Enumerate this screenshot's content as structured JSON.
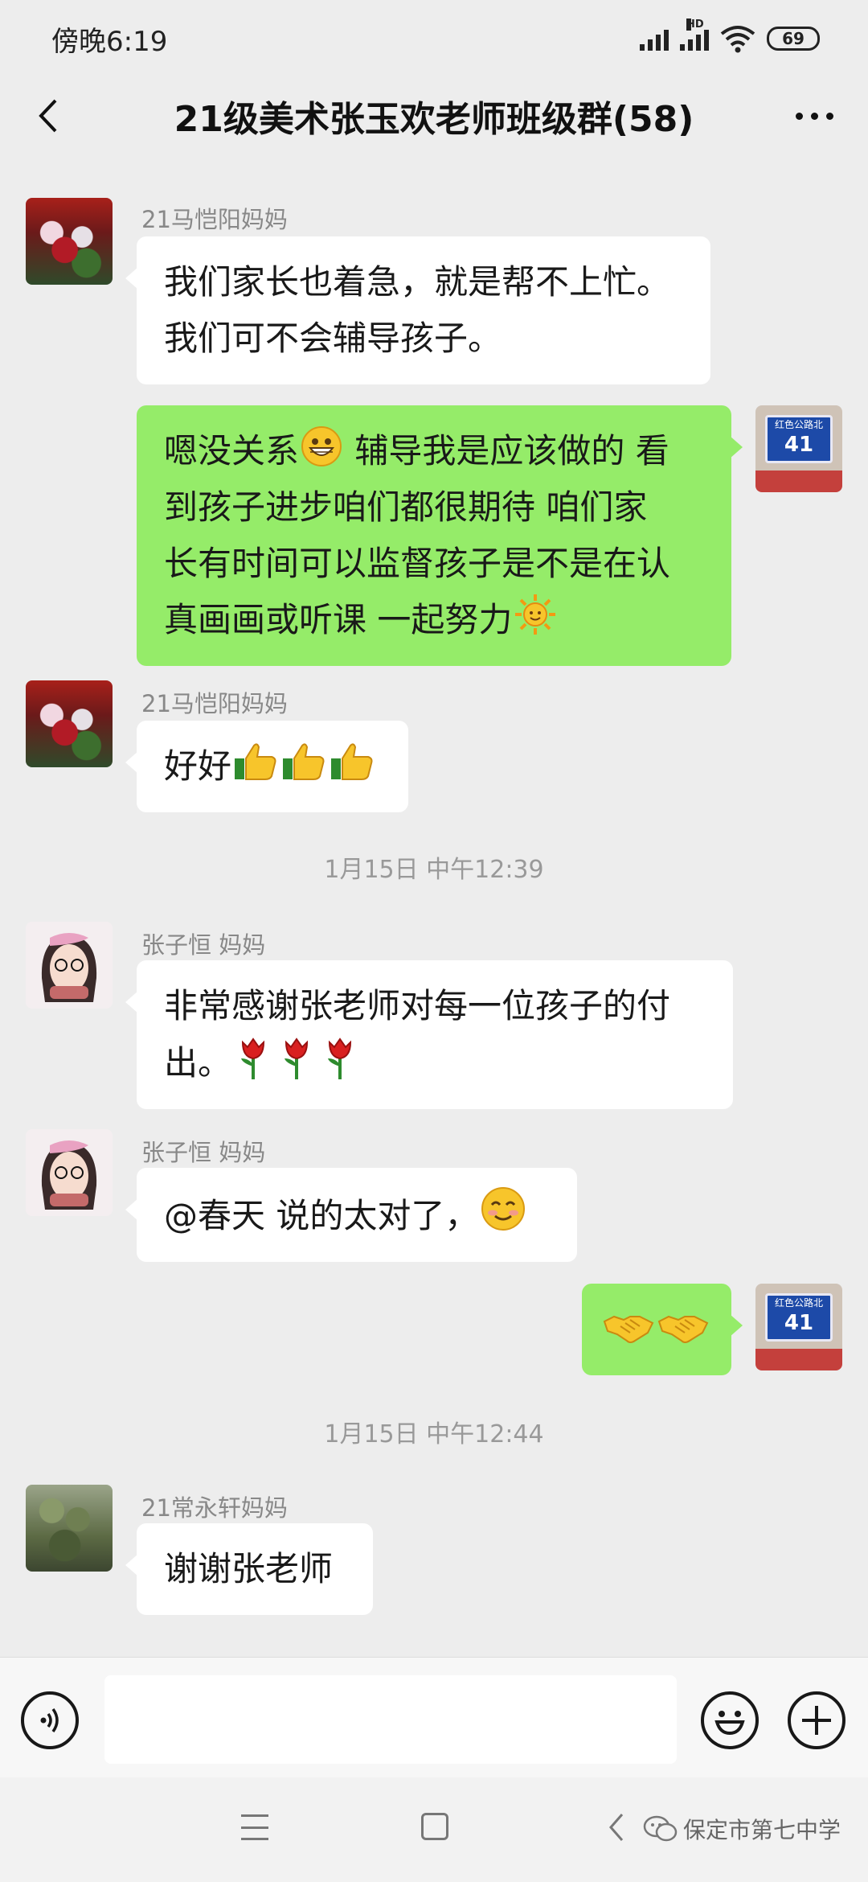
{
  "status_bar": {
    "time": "傍晚6:19",
    "hd": "HD",
    "battery": "69"
  },
  "header": {
    "title": "21级美术张玉欢老师班级群(58)"
  },
  "messages": [
    {
      "sender": "21马恺阳妈妈",
      "lines": [
        "我们家长也着急，就是帮不上忙。",
        "我们可不会辅导孩子。"
      ]
    },
    {
      "lines": [
        "嗯没关系",
        " 辅导我是应该做的 看",
        "到孩子进步咱们都很期待 咱们家",
        "长有时间可以监督孩子是不是在认",
        "真画画或听课 一起努力"
      ]
    },
    {
      "sender": "21马恺阳妈妈",
      "text": "好好"
    },
    {
      "sender": "张子恒  妈妈",
      "lines": [
        "非常感谢张老师对每一位孩子的付",
        "出。"
      ]
    },
    {
      "sender": "张子恒  妈妈",
      "text": "@春天  说的太对了，"
    },
    {
      "text": ""
    },
    {
      "sender": "21常永轩妈妈",
      "text": "谢谢张老师"
    }
  ],
  "timestamps": [
    "1月15日 中午12:39",
    "1月15日 中午12:44"
  ],
  "avatar_sign": {
    "line1": "红色公路北",
    "line2": "41"
  },
  "watermark": "保定市第七中学",
  "icons": {
    "emoji_grin": "grinning-face-icon",
    "emoji_sun": "sun-icon",
    "emoji_thumbs": "thumbs-up-icon",
    "emoji_rose": "rose-icon",
    "emoji_smile": "smiling-face-icon",
    "emoji_handshake": "handshake-icon"
  },
  "colors": {
    "background": "#ededed",
    "bubble_self": "#95ec69",
    "bubble_other": "#ffffff"
  }
}
